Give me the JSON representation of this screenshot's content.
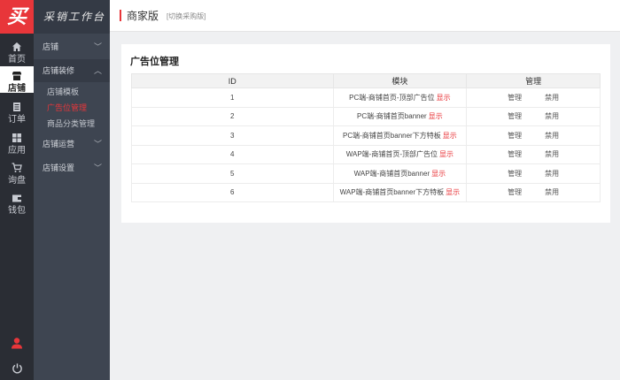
{
  "rail": {
    "logo": "买",
    "items": [
      {
        "label": "首页",
        "icon": "home-icon"
      },
      {
        "label": "店铺",
        "icon": "store-icon"
      },
      {
        "label": "订单",
        "icon": "order-icon"
      },
      {
        "label": "应用",
        "icon": "apps-icon"
      },
      {
        "label": "询盘",
        "icon": "cart-icon"
      },
      {
        "label": "钱包",
        "icon": "wallet-icon"
      }
    ]
  },
  "sidebar": {
    "brand": "采销工作台",
    "groups": [
      {
        "label": "店铺"
      },
      {
        "label": "店铺装修"
      },
      {
        "label": "店铺运营"
      },
      {
        "label": "店铺设置"
      }
    ],
    "subitems": [
      {
        "label": "店铺模板"
      },
      {
        "label": "广告位管理"
      },
      {
        "label": "商品分类管理"
      }
    ]
  },
  "header": {
    "title": "商家版",
    "switch_link": "[切换采购版]"
  },
  "main": {
    "title": "广告位管理",
    "columns": [
      "ID",
      "模块",
      "管理"
    ],
    "rows": [
      {
        "id": "1",
        "module": "PC端-商铺首页-顶部广告位",
        "show": "显示",
        "manage": "管理",
        "disable": "禁用"
      },
      {
        "id": "2",
        "module": "PC端-商铺首页banner",
        "show": "显示",
        "manage": "管理",
        "disable": "禁用"
      },
      {
        "id": "3",
        "module": "PC端-商铺首页banner下方特板",
        "show": "显示",
        "manage": "管理",
        "disable": "禁用"
      },
      {
        "id": "4",
        "module": "WAP端-商铺首页-顶部广告位",
        "show": "显示",
        "manage": "管理",
        "disable": "禁用"
      },
      {
        "id": "5",
        "module": "WAP端-商铺首页banner",
        "show": "显示",
        "manage": "管理",
        "disable": "禁用"
      },
      {
        "id": "6",
        "module": "WAP端-商铺首页banner下方特板",
        "show": "显示",
        "manage": "管理",
        "disable": "禁用"
      }
    ]
  },
  "colors": {
    "accent": "#e8363a",
    "rail_bg": "#2a2d34",
    "sidebar_bg": "#3e4551"
  }
}
